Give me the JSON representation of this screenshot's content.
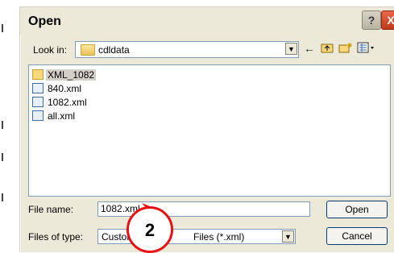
{
  "dialog": {
    "title": "Open",
    "help_button": "?",
    "close_button": "X"
  },
  "lookin": {
    "label": "Look in:",
    "value": "cdldata",
    "icon": "open-folder-icon"
  },
  "toolbar": {
    "back": "←",
    "up_folder": "up-folder-icon",
    "new_folder": "new-folder-icon",
    "views": "views-menu-icon"
  },
  "files": [
    {
      "name": "XML_1082",
      "type": "folder",
      "selected": true
    },
    {
      "name": "840.xml",
      "type": "xml"
    },
    {
      "name": "1082.xml",
      "type": "xml"
    },
    {
      "name": "all.xml",
      "type": "xml"
    }
  ],
  "filename": {
    "label": "File name:",
    "value": "1082.xml"
  },
  "filetype": {
    "label": "Files of type:",
    "value_start": "Customer",
    "value_end": "Files (*.xml)"
  },
  "buttons": {
    "open": "Open",
    "cancel": "Cancel"
  },
  "annotation": {
    "number": "2",
    "color": "#e81010"
  }
}
